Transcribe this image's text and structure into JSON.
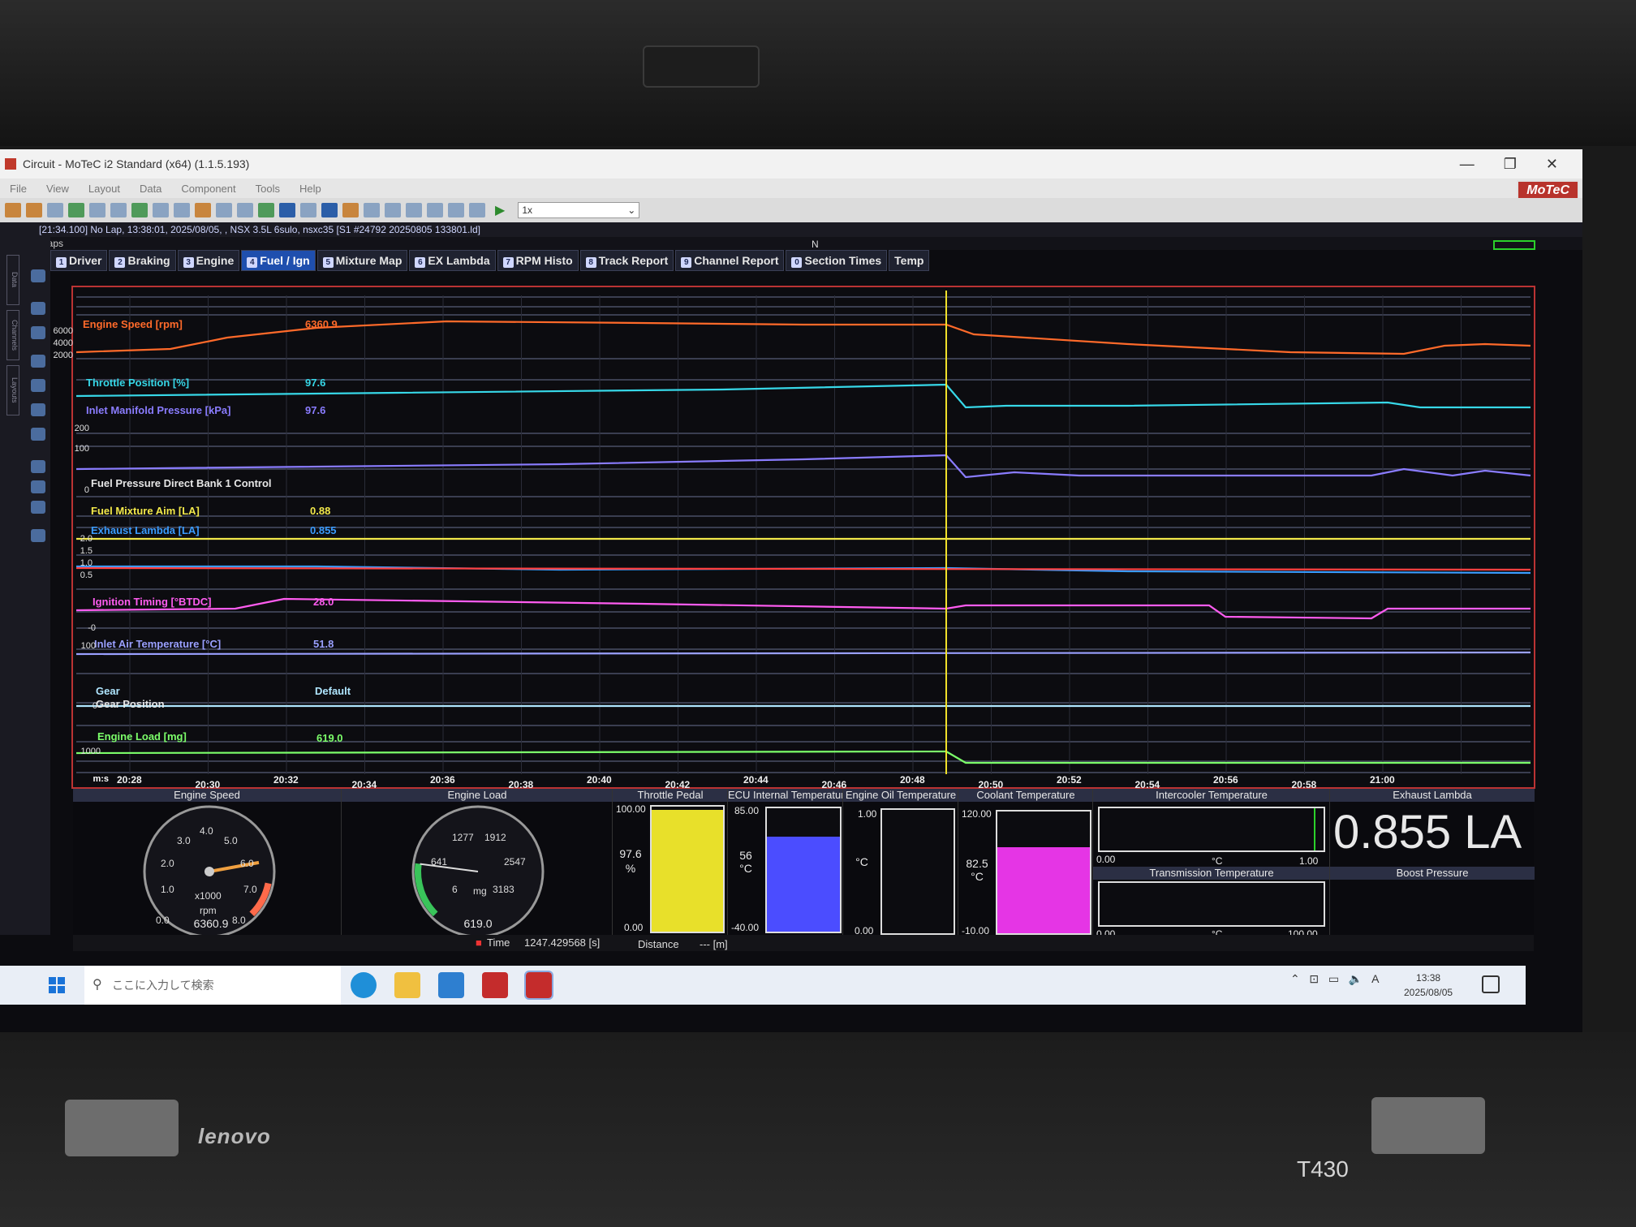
{
  "window": {
    "title": "Circuit - MoTeC i2 Standard (x64) (1.1.5.193)",
    "controls": [
      "—",
      "❐",
      "✕"
    ],
    "logo": "MoTeC"
  },
  "menu": [
    "File",
    "View",
    "Layout",
    "Data",
    "Component",
    "Tools",
    "Help"
  ],
  "toolbar": {
    "zoom_value": "1x"
  },
  "status_line": "[21:34.100] No Lap, 13:38:01, 2025/08/05, , NSX 3.5L 6sulo, nsxc35 [S1 #24792 20250805 133801.ld]",
  "laps_label": "Laps",
  "lap_marker": "N",
  "sidebar_tabs": [
    "Data",
    "Channels",
    "Layouts"
  ],
  "tabs": [
    {
      "num": "1",
      "label": "Driver"
    },
    {
      "num": "2",
      "label": "Braking"
    },
    {
      "num": "3",
      "label": "Engine"
    },
    {
      "num": "4",
      "label": "Fuel / Ign",
      "active": true
    },
    {
      "num": "5",
      "label": "Mixture Map"
    },
    {
      "num": "6",
      "label": "EX Lambda"
    },
    {
      "num": "7",
      "label": "RPM Histo"
    },
    {
      "num": "8",
      "label": "Track Report"
    },
    {
      "num": "9",
      "label": "Channel Report"
    },
    {
      "num": "0",
      "label": "Section Times"
    },
    {
      "num": "",
      "label": "Temp"
    }
  ],
  "channels": [
    {
      "name": "Engine Speed [rpm]",
      "value": "6360.9",
      "color": "#ff6a2a"
    },
    {
      "name": "Throttle Position [%]",
      "value": "97.6",
      "color": "#37d8e8"
    },
    {
      "name": "Inlet Manifold Pressure [kPa]",
      "value": "97.6",
      "color": "#8a7cff"
    },
    {
      "name": "Fuel Pressure Direct Bank 1 Control",
      "value": "",
      "color": "#e6e6e6"
    },
    {
      "name": "Fuel Mixture Aim [LA]",
      "value": "0.88",
      "color": "#f2e84a"
    },
    {
      "name": "Exhaust Lambda [LA]",
      "value": "0.855",
      "color": "#3b9cff"
    },
    {
      "name": "Ignition Timing [°BTDC]",
      "value": "28.0",
      "color": "#ff5cf0"
    },
    {
      "name": "Inlet Air Temperature [°C]",
      "value": "51.8",
      "color": "#9aa0ff"
    },
    {
      "name": "Gear",
      "value": "Default",
      "color": "#b0e6ff"
    },
    {
      "name": "Gear Position",
      "value": "",
      "color": "#e6e6e6"
    },
    {
      "name": "Engine Load [mg]",
      "value": "619.0",
      "color": "#7cff6a"
    }
  ],
  "y_ticks": {
    "engine_speed": [
      "6000",
      "4000",
      "2000"
    ],
    "pressure": [
      "200",
      "100",
      "0"
    ],
    "lambda": [
      "2.0",
      "1.5",
      "1.0",
      "0.5"
    ],
    "ignition": [
      "-0"
    ],
    "iat": [
      "100"
    ],
    "gear": [
      "0"
    ],
    "load": [
      "1000"
    ]
  },
  "x_axis": {
    "unit": "m:s",
    "ticks": [
      "20:28",
      "20:30",
      "20:32",
      "20:34",
      "20:36",
      "20:38",
      "20:40",
      "20:42",
      "20:44",
      "20:46",
      "20:48",
      "20:50",
      "20:52",
      "20:54",
      "20:56",
      "20:58",
      "21:00"
    ]
  },
  "gauges": {
    "engine_speed": {
      "title": "Engine Speed",
      "scale": [
        "0.0",
        "1.0",
        "2.0",
        "3.0",
        "4.0",
        "5.0",
        "6.0",
        "7.0",
        "8.0"
      ],
      "multiplier": "x1000",
      "unit": "rpm",
      "value": "6360.9",
      "needle": 6.36,
      "max": 8.0
    },
    "engine_load": {
      "title": "Engine Load",
      "scale": [
        "6",
        "641",
        "1277",
        "1912",
        "2547",
        "3183"
      ],
      "unit": "mg",
      "value": "619.0",
      "needle": 619.0,
      "max": 3183
    },
    "throttle_pedal": {
      "title": "Throttle Pedal",
      "max": "100.00",
      "min": "0.00",
      "value": "97.6",
      "unit": "%",
      "fill": 0.976,
      "color": "#e8e02a"
    },
    "ecu_temp": {
      "title": "ECU Internal Temperature",
      "max": "85.00",
      "min": "-40.00",
      "value": "56",
      "unit": "°C",
      "fill": 0.77,
      "color": "#4b4dff"
    },
    "oil_temp": {
      "title": "Engine Oil Temperature",
      "max": "1.00",
      "min": "0.00",
      "value": "",
      "unit": "°C",
      "fill": 0.0,
      "color": "#888888"
    },
    "coolant_temp": {
      "title": "Coolant Temperature",
      "max": "120.00",
      "min": "-10.00",
      "value": "82.5",
      "unit": "°C",
      "fill": 0.71,
      "color": "#e535e5"
    },
    "intercooler": {
      "title": "Intercooler Temperature",
      "min": "0.00",
      "max": "1.00",
      "unit": "°C"
    },
    "transmission": {
      "title": "Transmission Temperature",
      "min": "0.00",
      "max": "100.00",
      "unit": "°C"
    },
    "exhaust_lambda": {
      "title": "Exhaust Lambda",
      "value": "0.855 LA"
    },
    "boost_pressure": {
      "title": "Boost Pressure"
    }
  },
  "time_bar": {
    "time_label": "Time",
    "time_value": "1247.429568 [s]",
    "distance_label": "Distance",
    "distance_value": "--- [m]"
  },
  "taskbar": {
    "search_placeholder": "ここに入力して検索",
    "clock_time": "13:38",
    "clock_date": "2025/08/05",
    "ime": "A"
  },
  "laptop": {
    "brand": "lenovo",
    "model": "T430"
  }
}
